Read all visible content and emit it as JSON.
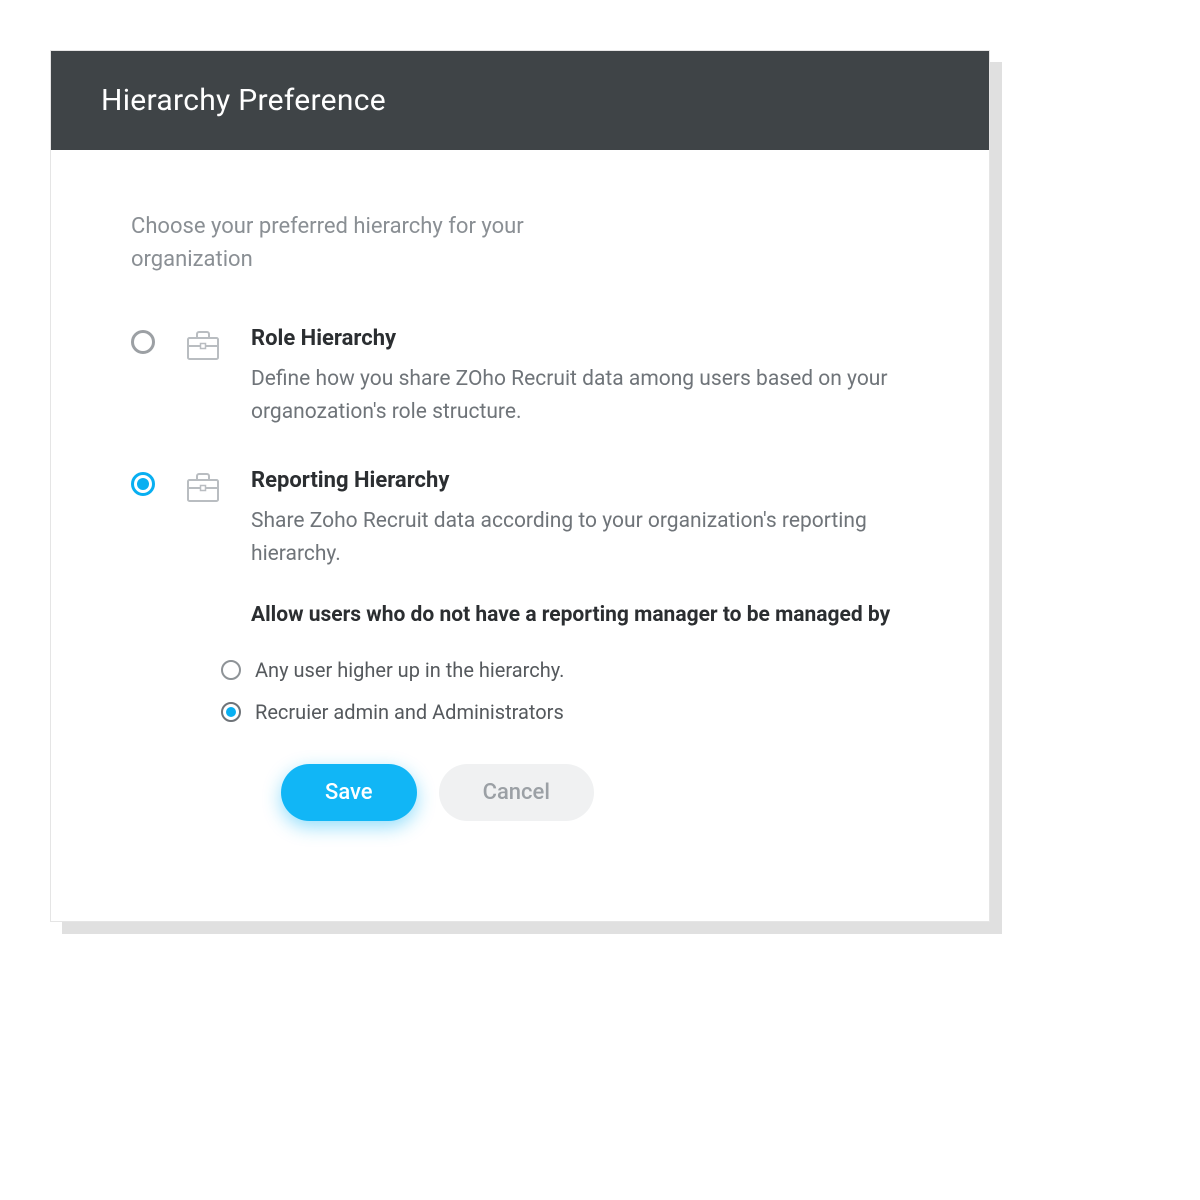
{
  "header": {
    "title": "Hierarchy Preference"
  },
  "body": {
    "intro": "Choose your preferred hierarchy for your organization",
    "options": [
      {
        "title": "Role Hierarchy",
        "description": "Define how you share ZOho Recruit data among users based on your organozation's role structure.",
        "selected": false
      },
      {
        "title": "Reporting Hierarchy",
        "description": "Share Zoho Recruit data according to your organization's reporting hierarchy.",
        "selected": true
      }
    ],
    "sub": {
      "heading": "Allow users who do not have a reporting manager to be managed by",
      "options": [
        {
          "label": "Any user higher up in the hierarchy.",
          "selected": false
        },
        {
          "label": "Recruier admin and Administrators",
          "selected": true
        }
      ]
    },
    "buttons": {
      "save": "Save",
      "cancel": "Cancel"
    }
  },
  "colors": {
    "header_bg": "#3f4447",
    "accent": "#11b6f6"
  }
}
